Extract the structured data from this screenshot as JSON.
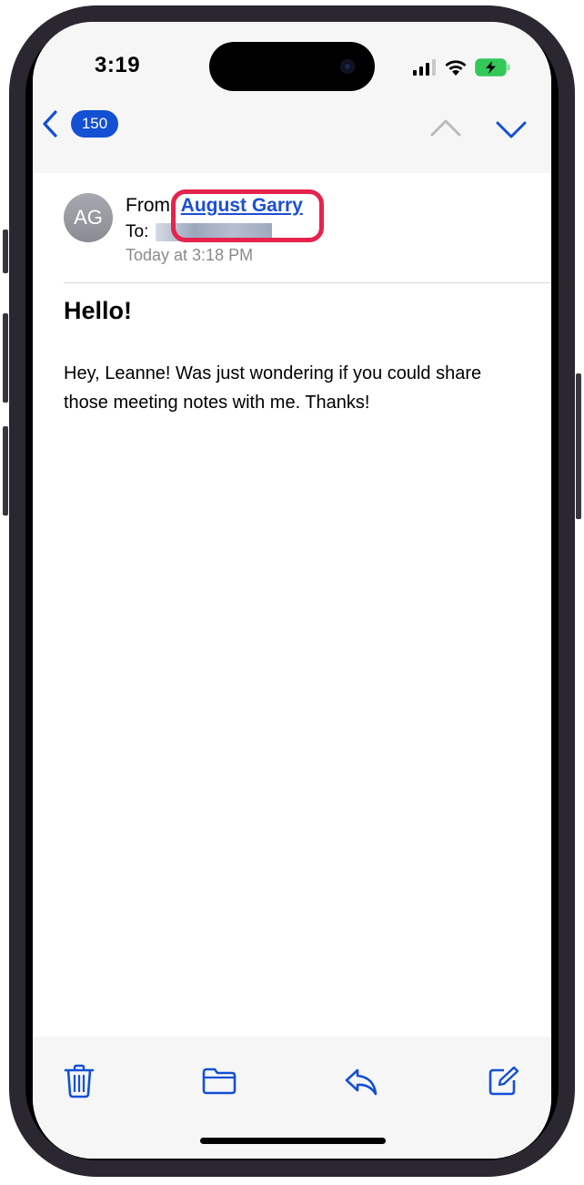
{
  "status_bar": {
    "time": "3:19"
  },
  "nav": {
    "unread_count": "150"
  },
  "email": {
    "avatar_initials": "AG",
    "from_label": "From:",
    "sender_name": "August Garry",
    "to_label": "To:",
    "date": "Today at 3:18 PM",
    "subject": "Hello!",
    "body": "Hey, Leanne! Was just wondering if you could share those meeting notes with me. Thanks!"
  },
  "colors": {
    "accent": "#1c4fd1",
    "highlight": "#e5234c",
    "battery_charging": "#34c759"
  },
  "icons": [
    "back-chevron-icon",
    "up-chevron-icon",
    "down-chevron-icon",
    "trash-icon",
    "folder-icon",
    "reply-icon",
    "compose-icon",
    "signal-icon",
    "wifi-icon",
    "battery-icon"
  ]
}
